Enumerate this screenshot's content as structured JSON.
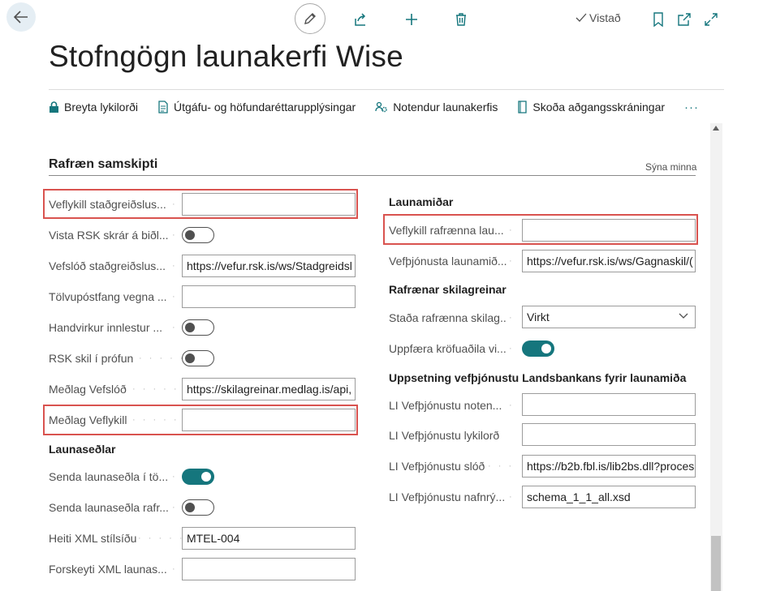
{
  "header": {
    "saved_label": "Vistað",
    "page_title": "Stofngögn launakerfi Wise"
  },
  "actions": [
    {
      "label": "Breyta lykilorði",
      "icon": "lock-icon"
    },
    {
      "label": "Útgáfu- og höfundaréttarupplýsingar",
      "icon": "document-info-icon"
    },
    {
      "label": "Notendur launakerfis",
      "icon": "users-gear-icon"
    },
    {
      "label": "Skoða aðgangsskráningar",
      "icon": "log-icon"
    }
  ],
  "more_actions": "···",
  "section": {
    "title": "Rafræn samskipti",
    "toggle_label": "Sýna minna"
  },
  "left_fields": [
    {
      "label": "Veflykill staðgreiðslus...",
      "type": "input",
      "value": ""
    },
    {
      "label": "Vista RSK skrár á biðl...",
      "type": "toggle",
      "value": "off"
    },
    {
      "label": "Vefslóð staðgreiðslus...",
      "type": "input",
      "value": "https://vefur.rsk.is/ws/Stadgreidsl"
    },
    {
      "label": "Tölvupóstfang vegna ...",
      "type": "input",
      "value": ""
    },
    {
      "label": "Handvirkur innlestur ...",
      "type": "toggle",
      "value": "off"
    },
    {
      "label": "RSK skil í prófun",
      "type": "toggle",
      "value": "off"
    },
    {
      "label": "Meðlag Vefslóð",
      "type": "input",
      "value": "https://skilagreinar.medlag.is/api,"
    },
    {
      "label": "Meðlag Veflykill",
      "type": "input",
      "value": ""
    }
  ],
  "payslips": {
    "title": "Launaseðlar",
    "fields": [
      {
        "label": "Senda launaseðla í tö...",
        "type": "toggle",
        "value": "on"
      },
      {
        "label": "Senda launaseðla rafr...",
        "type": "toggle",
        "value": "off"
      },
      {
        "label": "Heiti XML stílsíðu",
        "type": "input",
        "value": "MTEL-004"
      },
      {
        "label": "Forskeyti XML launas...",
        "type": "input",
        "value": ""
      }
    ]
  },
  "launamidar": {
    "title": "Launamiðar",
    "fields": [
      {
        "label": "Veflykill rafrænna lau...",
        "type": "input",
        "value": ""
      },
      {
        "label": "Vefþjónusta launamið...",
        "type": "input",
        "value": "https://vefur.rsk.is/ws/Gagnaskil/("
      }
    ]
  },
  "skilagreinar": {
    "title": "Rafrænar skilagreinar",
    "fields": [
      {
        "label": "Staða rafrænna skilag...",
        "type": "select",
        "value": "Virkt"
      },
      {
        "label": "Uppfæra kröfuaðila vi...",
        "type": "toggle",
        "value": "on"
      }
    ]
  },
  "landsbanki": {
    "title": "Uppsetning vefþjónustu Landsbankans fyrir launamiða",
    "fields": [
      {
        "label": "LI Vefþjónustu noten...",
        "type": "input",
        "value": ""
      },
      {
        "label": "LI Vefþjónustu lykilorð",
        "type": "input",
        "value": ""
      },
      {
        "label": "LI Vefþjónustu slóð",
        "type": "input",
        "value": "https://b2b.fbl.is/lib2bs.dll?proces"
      },
      {
        "label": "LI Vefþjónustu nafnrý...",
        "type": "input",
        "value": "schema_1_1_all.xsd"
      }
    ]
  },
  "colors": {
    "accent": "#15767d",
    "highlight": "#d9534f"
  }
}
